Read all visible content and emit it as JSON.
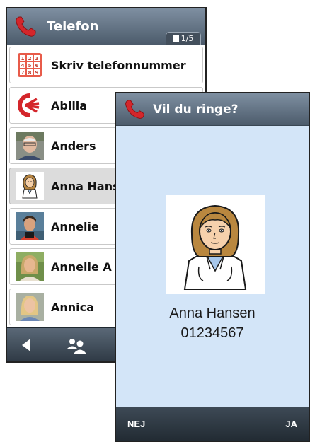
{
  "phone_screen": {
    "title": "Telefon",
    "page_indicator": "1/5",
    "contacts": [
      {
        "name": "Skriv telefonnummer",
        "icon": "keypad-icon"
      },
      {
        "name": "Abilia",
        "icon": "abilia-logo-icon"
      },
      {
        "name": "Anders",
        "icon": "contact-photo"
      },
      {
        "name": "Anna Hansen",
        "icon": "doctor-pictogram",
        "selected": true
      },
      {
        "name": "Annelie",
        "icon": "contact-photo"
      },
      {
        "name": "Annelie A",
        "icon": "contact-photo"
      },
      {
        "name": "Annica",
        "icon": "contact-photo"
      }
    ],
    "toolbar": [
      "back-arrow-icon",
      "contacts-icon",
      "keypad-icon"
    ]
  },
  "dialog": {
    "title": "Vil du ringe?",
    "contact_name": "Anna Hansen",
    "contact_number": "01234567",
    "no_label": "NEJ",
    "yes_label": "JA"
  },
  "colors": {
    "title_bar": "#5f6e7e",
    "dialog_background": "#d3e5f8",
    "phone_red": "#d4262b",
    "selected_row": "#dcdcdc"
  }
}
